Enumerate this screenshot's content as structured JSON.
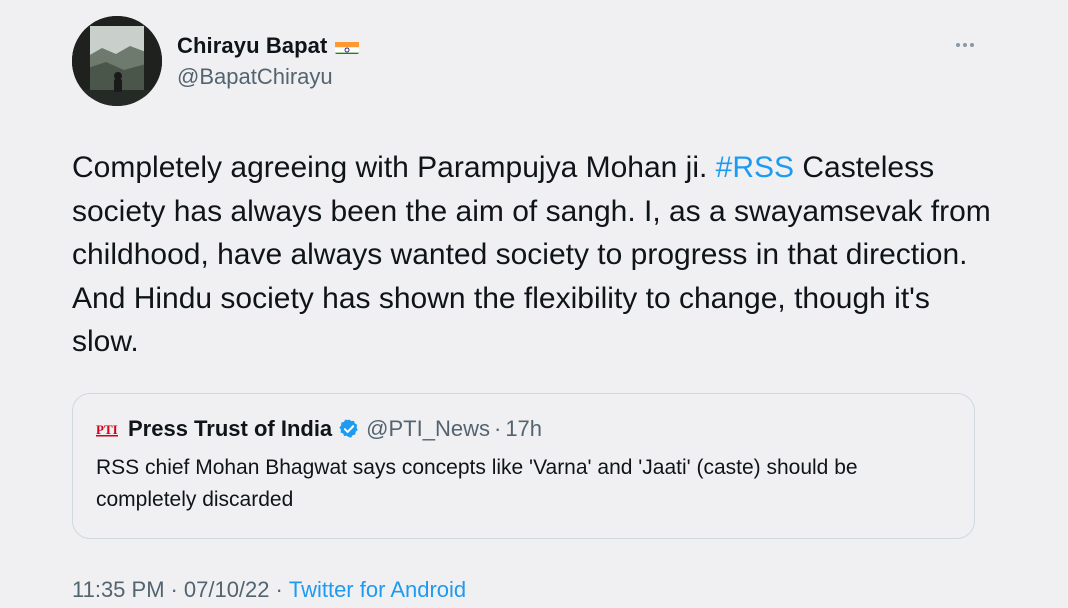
{
  "author": {
    "name": "Chirayu Bapat",
    "handle": "@BapatChirayu",
    "flag_icon": "india-flag-icon"
  },
  "more_icon": "more-horizontal-icon",
  "tweet": {
    "text_before_hashtag": "Completely agreeing with Parampujya Mohan ji. ",
    "hashtag": "#RSS",
    "text_after_hashtag": " Casteless society has always been the aim of sangh. I, as a swayamsevak from childhood, have always wanted society to progress in that direction. And Hindu society has shown the flexibility to change, though it's slow."
  },
  "quoted_tweet": {
    "logo_icon": "pti-logo-icon",
    "name": "Press Trust of India",
    "verified_icon": "verified-badge-icon",
    "handle": "@PTI_News",
    "separator": "·",
    "time": "17h",
    "text": "RSS chief Mohan Bhagwat says concepts like 'Varna' and 'Jaati' (caste) should be completely discarded"
  },
  "meta": {
    "time": "11:35 PM",
    "separator": "·",
    "date": "07/10/22",
    "source": "Twitter for Android"
  },
  "colors": {
    "background": "#f0f0f2",
    "text": "#0f1419",
    "secondary": "#536471",
    "link": "#1d9bf0",
    "border": "#cfd9de"
  }
}
